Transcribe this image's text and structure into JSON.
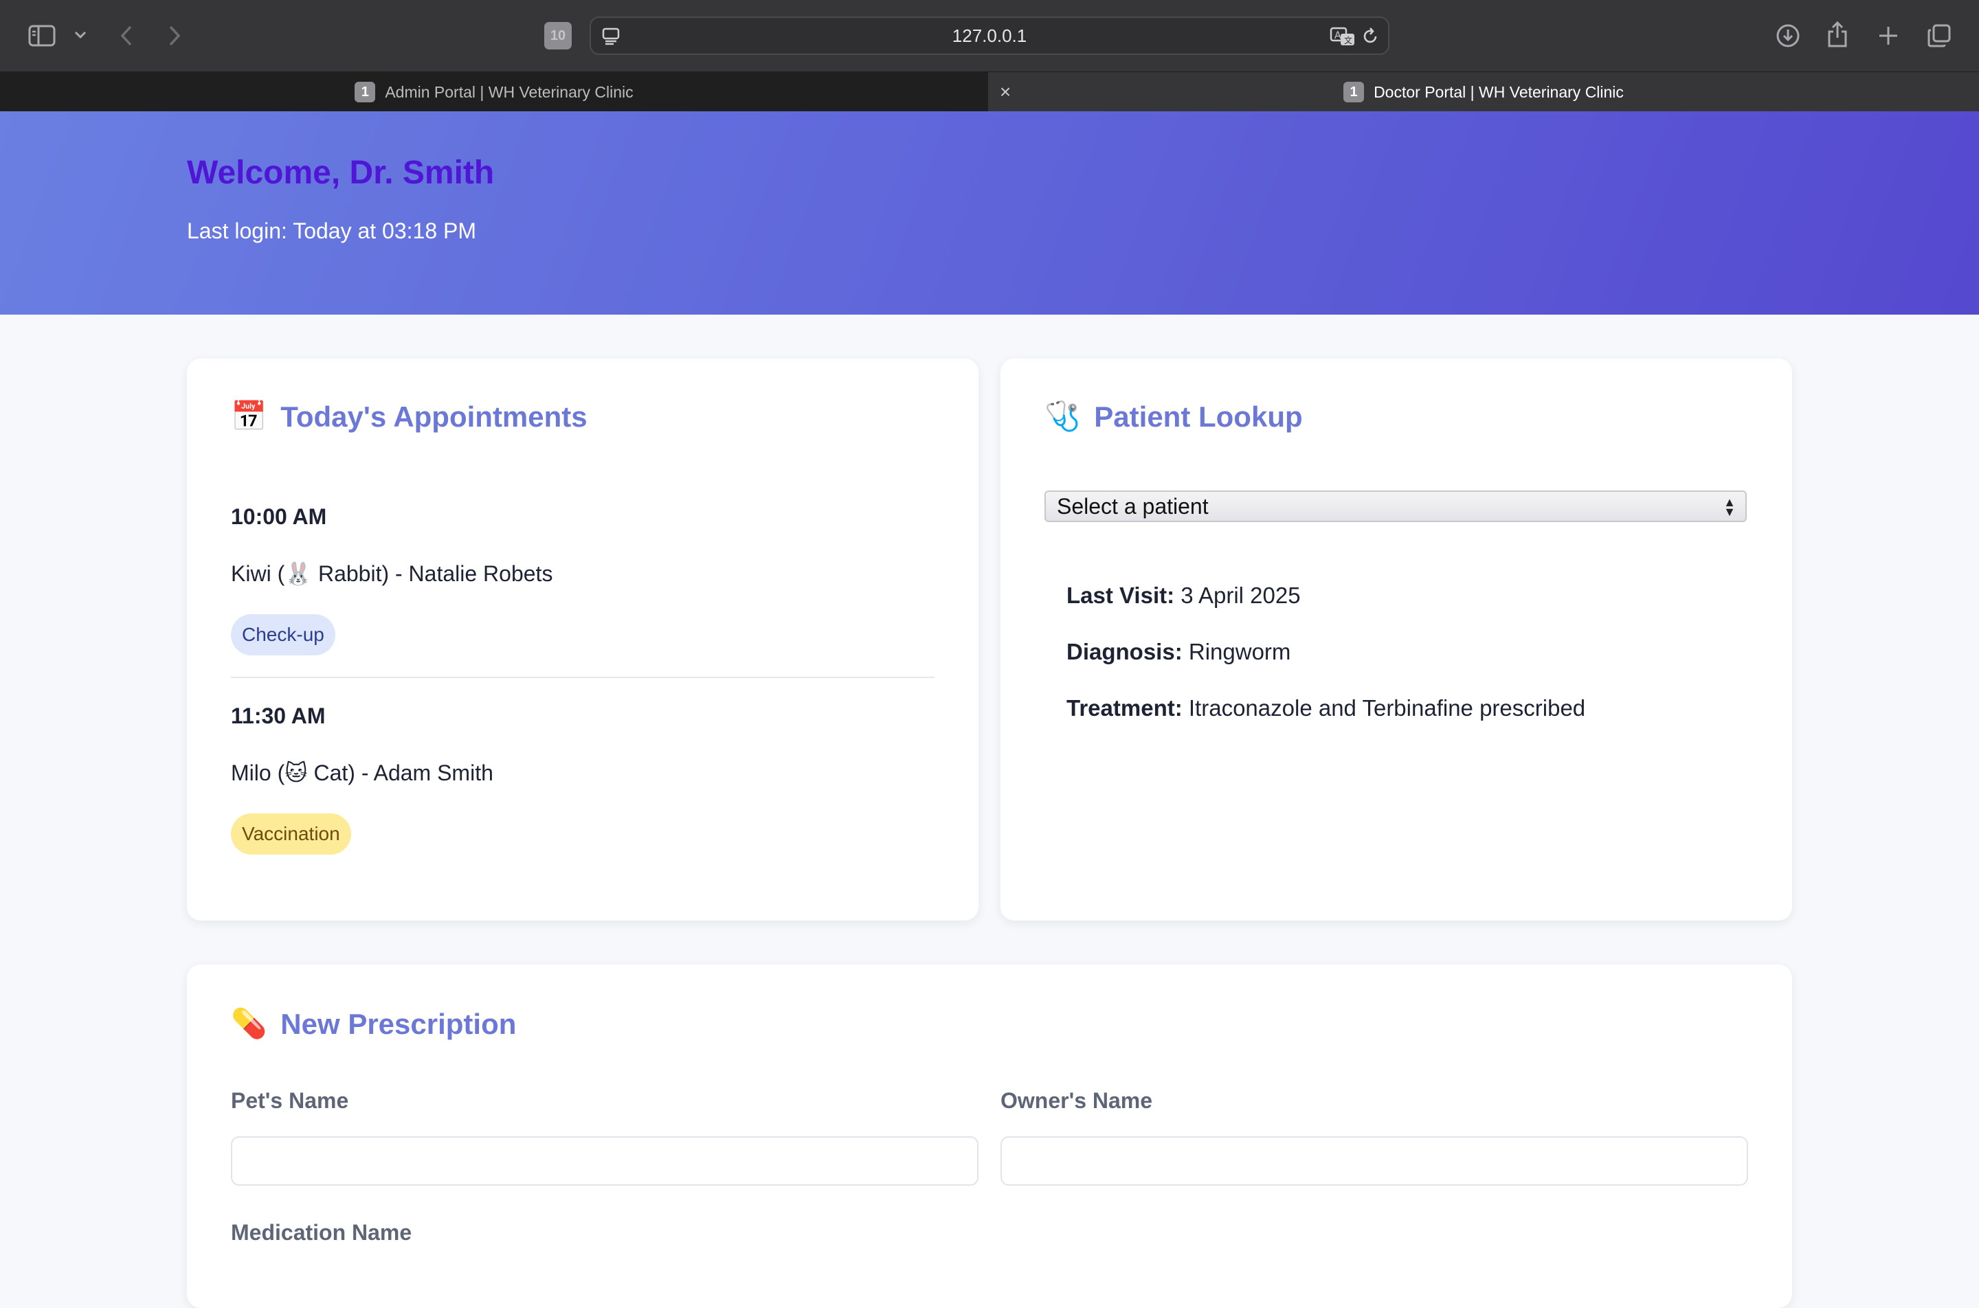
{
  "browser": {
    "address": "127.0.0.1",
    "toolbar_badge": "10",
    "tabs": [
      {
        "badge": "1",
        "title": "Admin Portal | WH Veterinary Clinic",
        "active": false
      },
      {
        "badge": "1",
        "title": "Doctor Portal | WH Veterinary Clinic",
        "active": true
      }
    ],
    "icons": [
      "sidebar-icon",
      "chevron-down-icon",
      "back-icon",
      "forward-icon",
      "reader-icon",
      "translate-icon",
      "reload-icon",
      "download-icon",
      "share-icon",
      "new-tab-icon",
      "tab-overview-icon",
      "tab-close-icon"
    ]
  },
  "header": {
    "title": "Welcome, Dr. Smith",
    "last_login": "Last login: Today at 03:18 PM",
    "gradient": [
      "#6a7fe2",
      "#5549cf"
    ],
    "title_color": "#4f16d6"
  },
  "appointments": {
    "icon": "📅",
    "title": "Today's Appointments",
    "items": [
      {
        "time": "10:00 AM",
        "description": "Kiwi (🐰 Rabbit) - Natalie Robets",
        "type": "Check-up"
      },
      {
        "time": "11:30 AM",
        "description": "Milo (🐱 Cat) - Adam Smith",
        "type": "Vaccination"
      }
    ]
  },
  "lookup": {
    "icon": "🩺",
    "title": "Patient Lookup",
    "select_value": "Select a patient",
    "last_visit_label": "Last Visit:",
    "last_visit": "3 April 2025",
    "diagnosis_label": "Diagnosis:",
    "diagnosis": "Ringworm",
    "treatment_label": "Treatment:",
    "treatment": "Itraconazole and Terbinafine prescribed"
  },
  "prescription": {
    "icon": "💊",
    "title": "New Prescription",
    "pet_name_label": "Pet's Name",
    "pet_name_value": "",
    "owner_name_label": "Owner's Name",
    "owner_name_value": "",
    "medication_label": "Medication Name"
  },
  "colors": {
    "accent": "#6b78d6",
    "checkup_badge_bg": "#dde6fb",
    "vaccination_badge_bg": "#fdeb98"
  }
}
